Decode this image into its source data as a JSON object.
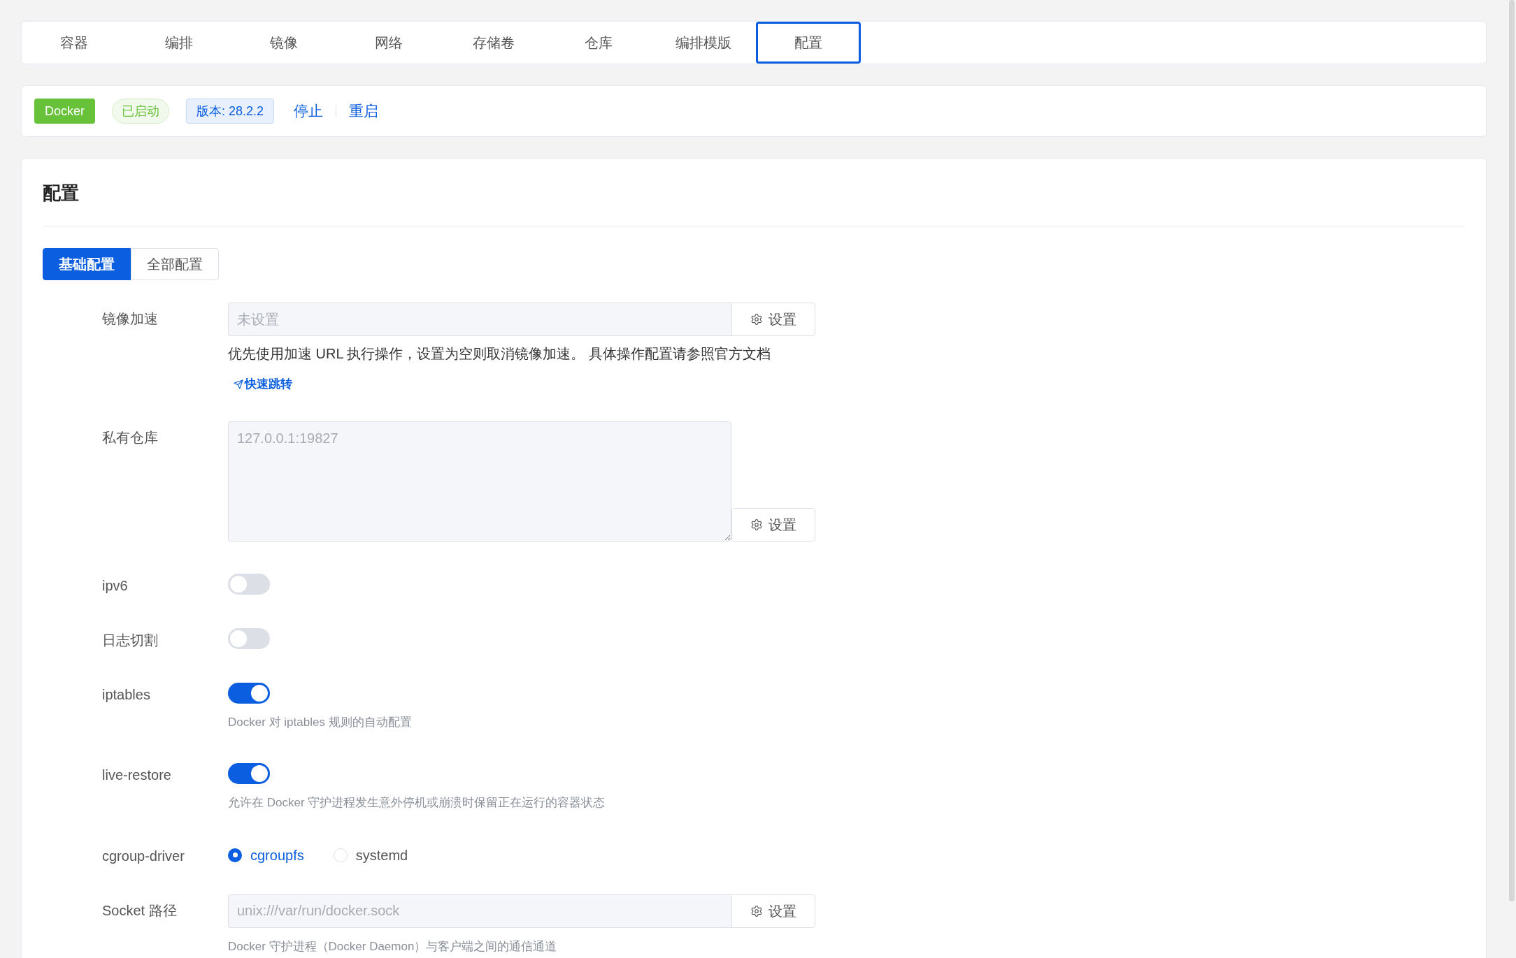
{
  "tabs": [
    {
      "label": "容器",
      "selected": false
    },
    {
      "label": "编排",
      "selected": false
    },
    {
      "label": "镜像",
      "selected": false
    },
    {
      "label": "网络",
      "selected": false
    },
    {
      "label": "存储卷",
      "selected": false
    },
    {
      "label": "仓库",
      "selected": false
    },
    {
      "label": "编排模版",
      "selected": false
    },
    {
      "label": "配置",
      "selected": true
    }
  ],
  "status": {
    "badge": "Docker",
    "state": "已启动",
    "version": "版本: 28.2.2",
    "actions": [
      "停止",
      "重启"
    ]
  },
  "panel": {
    "title": "配置",
    "segments": [
      {
        "label": "基础配置",
        "selected": true
      },
      {
        "label": "全部配置",
        "selected": false
      }
    ],
    "fields": [
      {
        "kind": "input",
        "label": "镜像加速",
        "placeholder": "未设置",
        "button": "设置",
        "description": "优先使用加速 URL 执行操作，设置为空则取消镜像加速。 具体操作配置请参照官方文档",
        "link": "快速跳转"
      },
      {
        "kind": "textarea",
        "label": "私有仓库",
        "placeholder": "127.0.0.1:19827",
        "button": "设置"
      },
      {
        "kind": "switch",
        "label": "ipv6",
        "on": false
      },
      {
        "kind": "switch",
        "label": "日志切割",
        "on": false
      },
      {
        "kind": "switch",
        "label": "iptables",
        "on": true,
        "hint": "Docker 对 iptables 规则的自动配置"
      },
      {
        "kind": "switch",
        "label": "live-restore",
        "on": true,
        "hint": "允许在 Docker 守护进程发生意外停机或崩溃时保留正在运行的容器状态"
      },
      {
        "kind": "radio",
        "label": "cgroup-driver",
        "options": [
          {
            "label": "cgroupfs",
            "selected": true
          },
          {
            "label": "systemd",
            "selected": false
          }
        ]
      },
      {
        "kind": "input",
        "label": "Socket 路径",
        "placeholder": "unix:///var/run/docker.sock",
        "button": "设置",
        "hint": "Docker 守护进程（Docker Daemon）与客户端之间的通信通道"
      }
    ]
  }
}
